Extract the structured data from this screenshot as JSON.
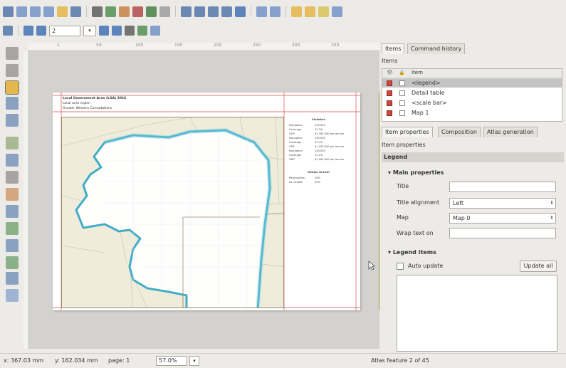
{
  "toolbar_main": {
    "icons": [
      {
        "name": "save-icon",
        "color": "#4a6fa5"
      },
      {
        "name": "new-composer-icon",
        "color": "#6b8fc4"
      },
      {
        "name": "duplicate-composer-icon",
        "color": "#6b8fc4"
      },
      {
        "name": "composer-manager-icon",
        "color": "#6b8fc4"
      },
      {
        "name": "open-folder-icon",
        "color": "#e3b23c"
      },
      {
        "name": "save-template-icon",
        "color": "#4a6fa5"
      },
      {
        "name": "print-icon",
        "color": "#555555"
      },
      {
        "name": "export-image-icon",
        "color": "#4a8a4a"
      },
      {
        "name": "export-svg-icon",
        "color": "#c47a3a"
      },
      {
        "name": "export-pdf-icon",
        "color": "#b04040"
      },
      {
        "name": "undo-icon",
        "color": "#3a7a3a"
      },
      {
        "name": "redo-icon",
        "color": "#999999"
      },
      {
        "name": "zoom-full-icon",
        "color": "#4a6fa5"
      },
      {
        "name": "zoom-100-icon",
        "color": "#4a6fa5"
      },
      {
        "name": "zoom-in-icon",
        "color": "#4a6fa5"
      },
      {
        "name": "zoom-out-icon",
        "color": "#4a6fa5"
      },
      {
        "name": "refresh-icon",
        "color": "#3a6ab0"
      },
      {
        "name": "group-icon",
        "color": "#6b8fc4"
      },
      {
        "name": "ungroup-icon",
        "color": "#6b8fc4"
      },
      {
        "name": "lock-icon",
        "color": "#e3b23c"
      },
      {
        "name": "unlock-icon",
        "color": "#e3b23c"
      },
      {
        "name": "raise-items-icon",
        "color": "#d4c24a"
      },
      {
        "name": "align-items-icon",
        "color": "#6b8fc4"
      }
    ]
  },
  "toolbar_atlas": {
    "page_value": "2",
    "icons": [
      {
        "name": "atlas-preview-icon",
        "color": "#4a6fa5"
      },
      {
        "name": "first-feature-icon",
        "color": "#3a6ab0"
      },
      {
        "name": "previous-feature-icon",
        "color": "#3a6ab0"
      },
      {
        "name": "next-feature-icon",
        "color": "#3a6ab0"
      },
      {
        "name": "last-feature-icon",
        "color": "#3a6ab0"
      },
      {
        "name": "print-atlas-icon",
        "color": "#555555"
      },
      {
        "name": "export-atlas-icon",
        "color": "#4a8a4a"
      },
      {
        "name": "atlas-settings-icon",
        "color": "#6b8fc4"
      }
    ]
  },
  "left_tools": [
    {
      "name": "pan-tool-icon",
      "color": "#777777"
    },
    {
      "name": "zoom-tool-icon",
      "color": "#777777"
    },
    {
      "name": "select-tool-icon",
      "color": "#e3b23c"
    },
    {
      "name": "move-content-tool-icon",
      "color": "#4a6fa5"
    },
    {
      "name": "edit-nodes-tool-icon",
      "color": "#4a6fa5"
    },
    {
      "name": "add-map-tool-icon",
      "color": "#7a9a5a"
    },
    {
      "name": "add-image-tool-icon",
      "color": "#4a6fa5"
    },
    {
      "name": "add-label-tool-icon",
      "color": "#777777"
    },
    {
      "name": "add-legend-tool-icon",
      "color": "#c47a3a"
    },
    {
      "name": "add-scalebar-tool-icon",
      "color": "#4a6fa5"
    },
    {
      "name": "add-shape-tool-icon",
      "color": "#4a8a4a"
    },
    {
      "name": "add-arrow-tool-icon",
      "color": "#4a6fa5"
    },
    {
      "name": "add-polyline-tool-icon",
      "color": "#4a8a4a"
    },
    {
      "name": "add-table-tool-icon",
      "color": "#4a6fa5"
    },
    {
      "name": "add-html-tool-icon",
      "color": "#6b8fc4"
    }
  ],
  "ruler": {
    "labels": [
      "1",
      "50",
      "100",
      "150",
      "200",
      "250",
      "300",
      "350"
    ]
  },
  "paper": {
    "title_line1": "Local Government Area (LGA) 2016",
    "title_line2": "Local area region",
    "title_line3": "Greater Western Consultations",
    "legend_heading": "Statistics",
    "legend_rows": [
      [
        "Population",
        "245,000"
      ],
      [
        "Coverage",
        "12.3%"
      ],
      [
        "GDP",
        "$1,345,000 per annum"
      ],
      [
        "Population",
        "245,000"
      ],
      [
        "Coverage",
        "12.3%"
      ],
      [
        "GDP",
        "$1,345,000 per annum"
      ],
      [
        "Population",
        "245,000"
      ],
      [
        "Coverage",
        "12.3%"
      ],
      [
        "GDP",
        "$1,345,000 per annum"
      ]
    ],
    "legend_sub": "Median Growth",
    "legend_rows2": [
      [
        "Participation",
        "28%"
      ],
      [
        "Av. Growth",
        "45%"
      ]
    ],
    "colors": {
      "land": "#efecdb",
      "water": "#ffffff",
      "coast": "#3aa9c4",
      "border": "#9b8f6c"
    }
  },
  "right_panel": {
    "tabs_top": [
      "Items",
      "Command history"
    ],
    "items_label": "Items",
    "items_header": "Item",
    "items": [
      {
        "name": "<legend>",
        "selected": true
      },
      {
        "name": "Detail table",
        "selected": false
      },
      {
        "name": "<scale bar>",
        "selected": false
      },
      {
        "name": "Map 1",
        "selected": false
      }
    ],
    "tabs_bottom": [
      "Item properties",
      "Composition",
      "Atlas generation"
    ],
    "item_props_label": "Item properties",
    "section": "Legend",
    "main_props": "Main properties",
    "fields": {
      "title_label": "Title",
      "title_value": "",
      "align_label": "Title alignment",
      "align_value": "Left",
      "map_label": "Map",
      "map_value": "Map 0",
      "wrap_label": "Wrap text on",
      "wrap_value": ""
    },
    "legend_items": "Legend items",
    "auto_update": "Auto update",
    "update_all": "Update all"
  },
  "status": {
    "x": "x: 367.03 mm",
    "y": "y: 162.034 mm",
    "page": "page: 1",
    "zoom": "57.0%",
    "atlas": "Atlas feature 2 of 45"
  }
}
